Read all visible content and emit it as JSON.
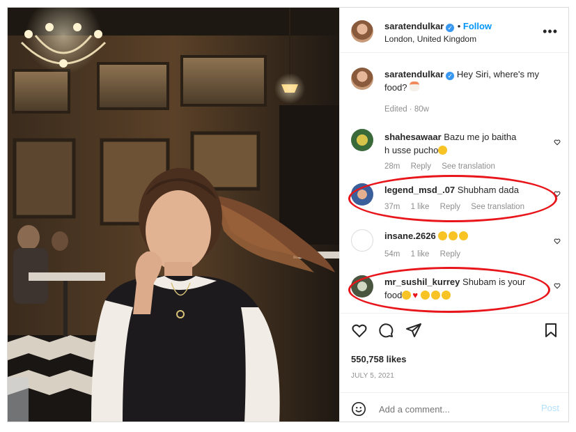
{
  "post": {
    "author": "saratendulkar",
    "follow_label": "Follow",
    "location": "London, United Kingdom",
    "more_label": "•••"
  },
  "caption": {
    "author": "saratendulkar",
    "text": "Hey Siri, where's my food?",
    "meta": "Edited · 80w"
  },
  "comments": [
    {
      "user": "shahesawaar",
      "text": "Bazu me jo baitha h usse pucho",
      "emojis": [
        "grin"
      ],
      "time": "28m",
      "likes": "",
      "reply": "Reply",
      "translate": "See translation"
    },
    {
      "user": "legend_msd_.07",
      "text": "Shubham dada",
      "emojis": [],
      "time": "37m",
      "likes": "1 like",
      "reply": "Reply",
      "translate": "See translation"
    },
    {
      "user": "insane.2626",
      "text": "",
      "emojis": [
        "joy",
        "joy",
        "joy"
      ],
      "time": "54m",
      "likes": "1 like",
      "reply": "Reply",
      "translate": ""
    },
    {
      "user": "mr_sushil_kurrey",
      "text": "Shubam is your food",
      "emojis": [
        "heart-eyes",
        "heart",
        "joy",
        "joy",
        "joy"
      ],
      "time": "",
      "likes": "",
      "reply": "",
      "translate": ""
    }
  ],
  "stats": {
    "likes": "550,758 likes",
    "date": "JULY 5, 2021"
  },
  "add_comment": {
    "placeholder": "Add a comment...",
    "post_label": "Post"
  },
  "colors": {
    "link": "#0095f6",
    "post_disabled": "#b2dffc",
    "highlight": "#e8151b"
  },
  "icons": [
    "heart-icon",
    "comment-icon",
    "share-icon",
    "bookmark-icon",
    "emoji-icon",
    "more-icon",
    "verified-icon"
  ]
}
